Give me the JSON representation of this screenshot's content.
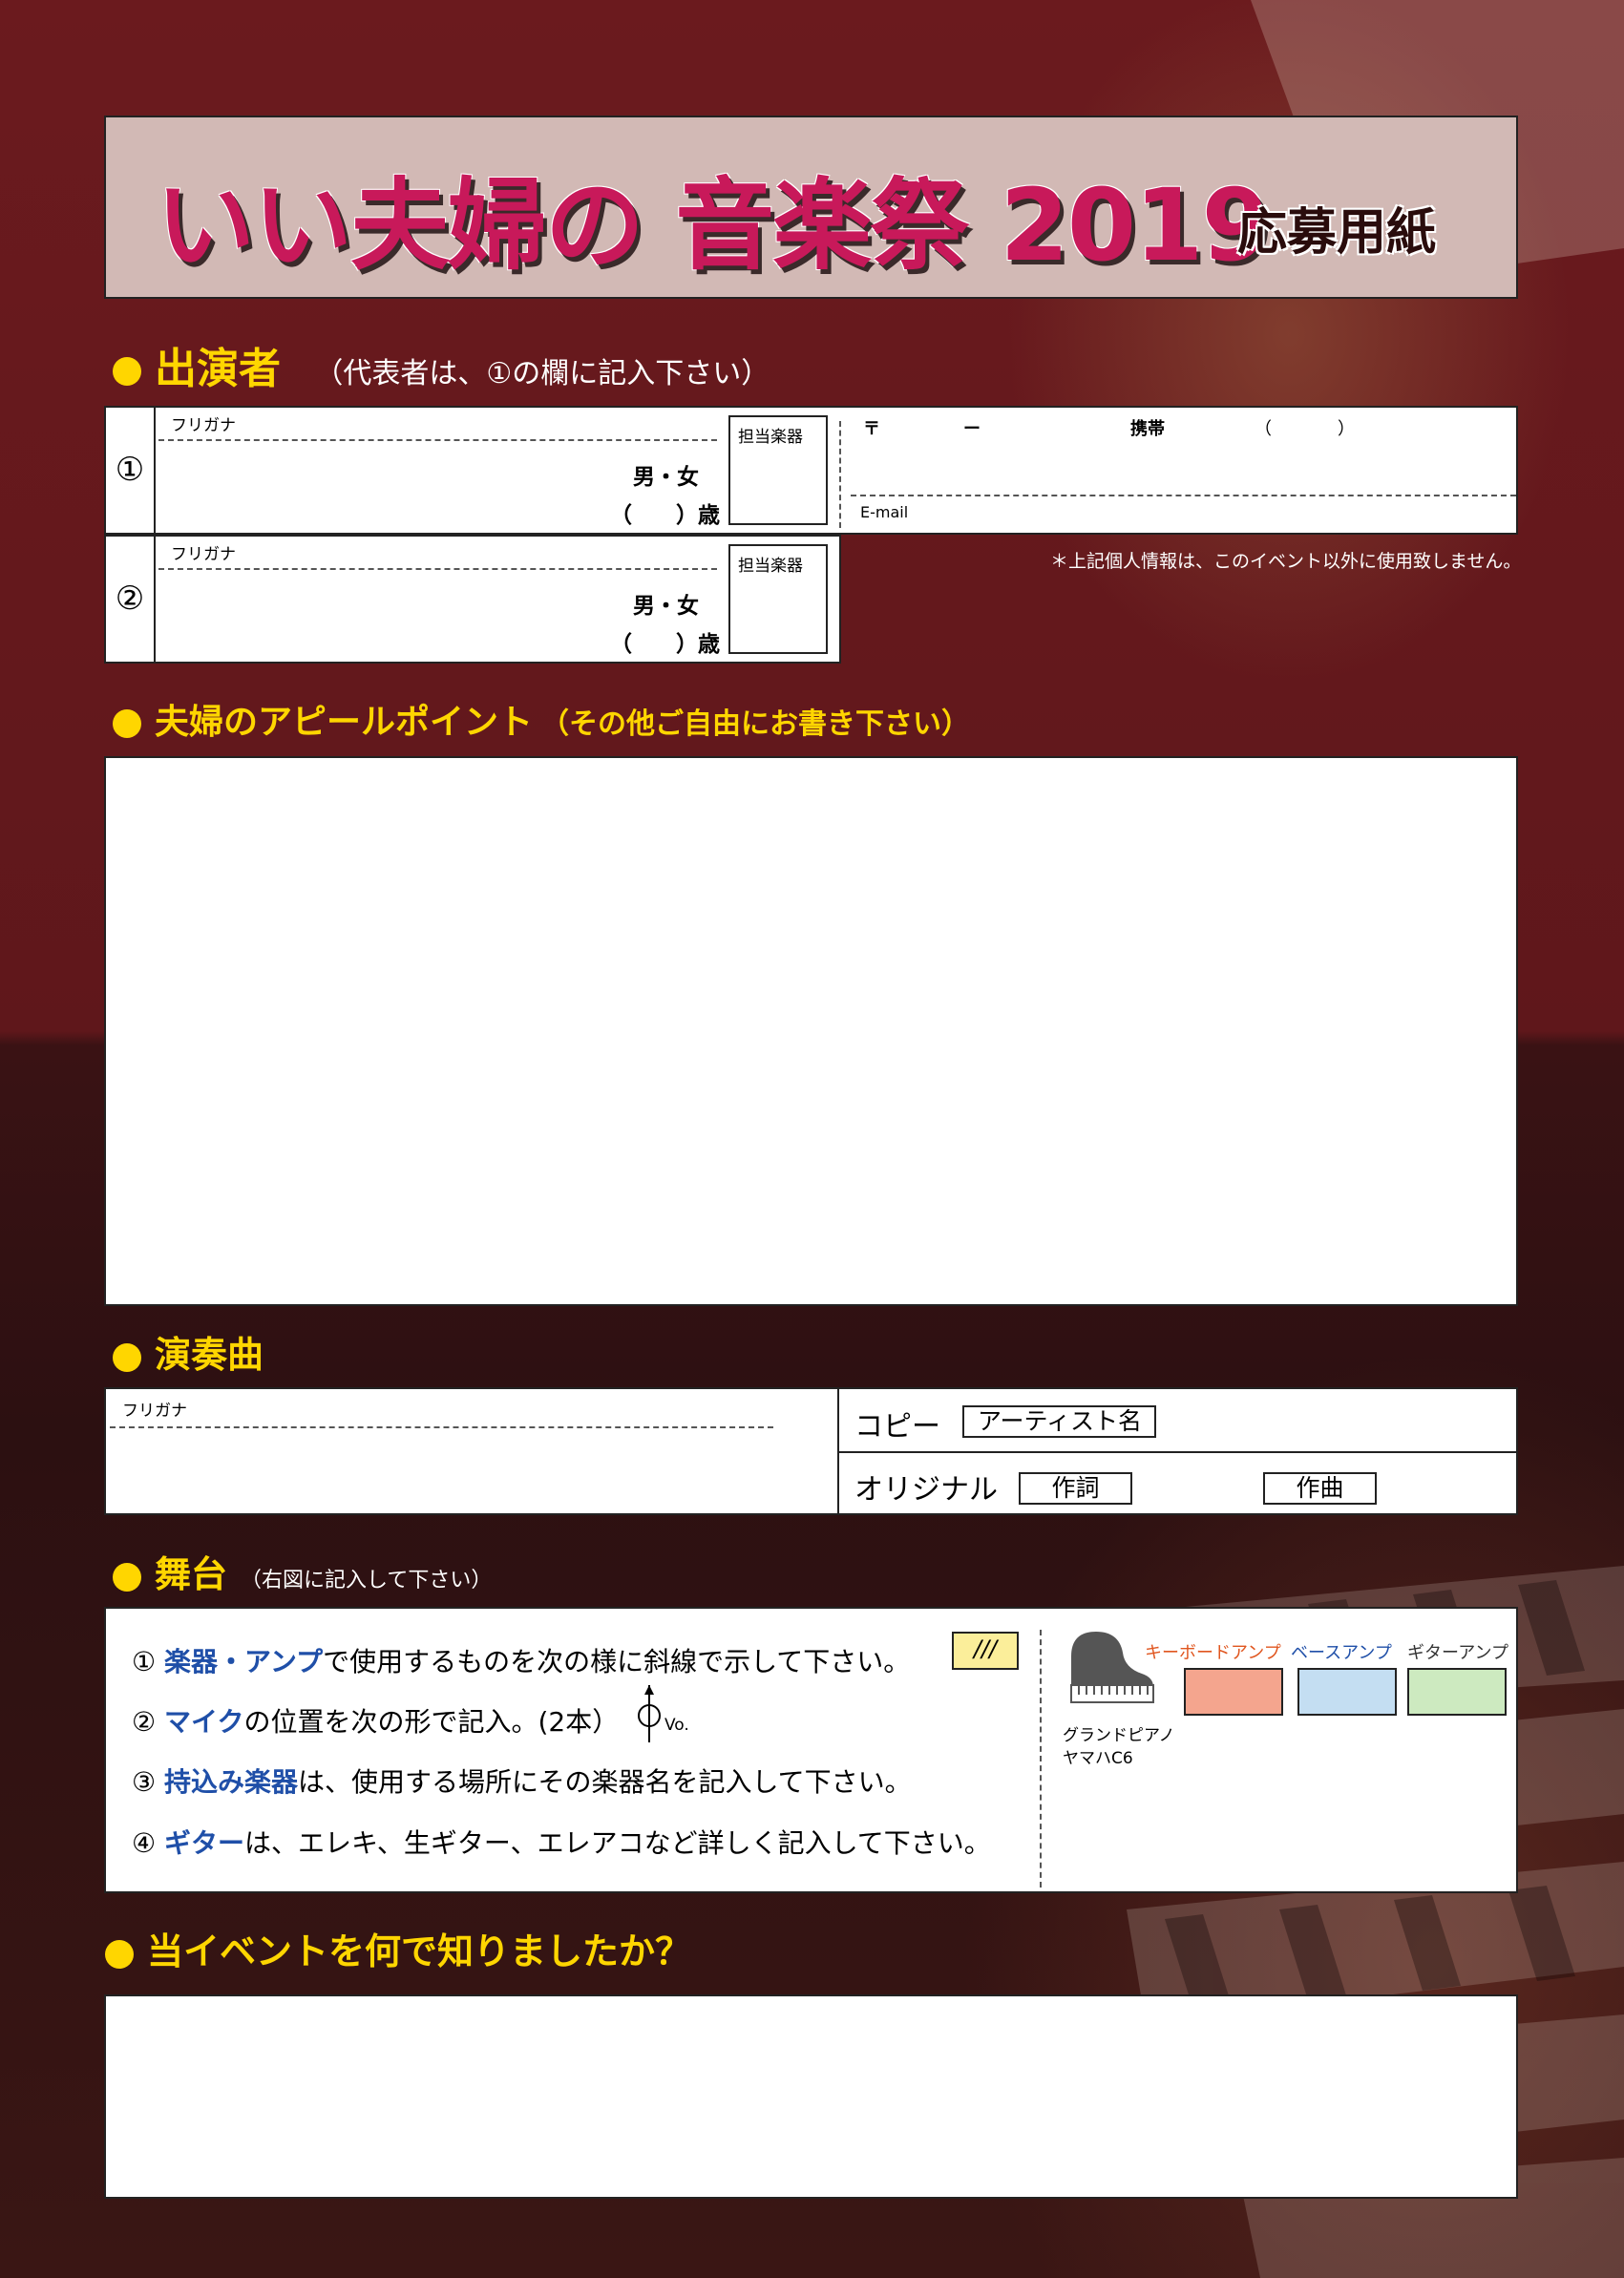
{
  "title": {
    "main": "いい夫婦の 音楽祭 2019",
    "sub": "応募用紙"
  },
  "performers": {
    "heading": "出演者",
    "note": "（代表者は、①の欄に記入下さい）",
    "rows": [
      {
        "num": "①",
        "furigana": "フリガナ",
        "gender": "男・女",
        "age": "（　　）歳",
        "instrument": "担当楽器"
      },
      {
        "num": "②",
        "furigana": "フリガナ",
        "gender": "男・女",
        "age": "（　　）歳",
        "instrument": "担当楽器"
      }
    ],
    "contact": {
      "postal": "〒",
      "dash": "ー",
      "mobile": "携帯",
      "paren_open": "（",
      "paren_close": "）",
      "email": "E-mail"
    },
    "privacy_note": "＊上記個人情報は、このイベント以外に使用致しません。"
  },
  "appeal": {
    "heading": "夫婦のアピールポイント",
    "note": "（その他ご自由にお書き下さい）"
  },
  "songs": {
    "heading": "演奏曲",
    "furigana": "フリガナ",
    "copy_label": "コピー",
    "artist_label": "アーティスト名",
    "original_label": "オリジナル",
    "lyrics_label": "作詞",
    "composition_label": "作曲"
  },
  "stage": {
    "heading": "舞台",
    "note": "（右図に記入して下さい）",
    "instructions": [
      {
        "num": "①",
        "highlight": "楽器・アンプ",
        "text": "で使用するものを次の様に斜線で示して下さい。"
      },
      {
        "num": "②",
        "highlight": "マイク",
        "text": "の位置を次の形で記入。(2本）"
      },
      {
        "num": "③",
        "highlight": "持込み楽器",
        "text": "は、使用する場所にその楽器名を記入して下さい。"
      },
      {
        "num": "④",
        "highlight": "ギター",
        "text": "は、エレキ、生ギター、エレアコなど詳しく記入して下さい。"
      }
    ],
    "hatch_sample": "///",
    "mic_label": "Vo.",
    "piano_label_1": "グランドピアノ",
    "piano_label_2": "ヤマハC6",
    "amps": [
      {
        "label": "キーボードアンプ",
        "color": "#f4a58e",
        "label_color": "#e0561f"
      },
      {
        "label": "ベースアンプ",
        "color": "#c4def2",
        "label_color": "#1f4fa8"
      },
      {
        "label": "ギターアンプ",
        "color": "#cdeac0",
        "label_color": "#333333"
      }
    ]
  },
  "source": {
    "heading": "当イベントを何で知りましたか？"
  }
}
